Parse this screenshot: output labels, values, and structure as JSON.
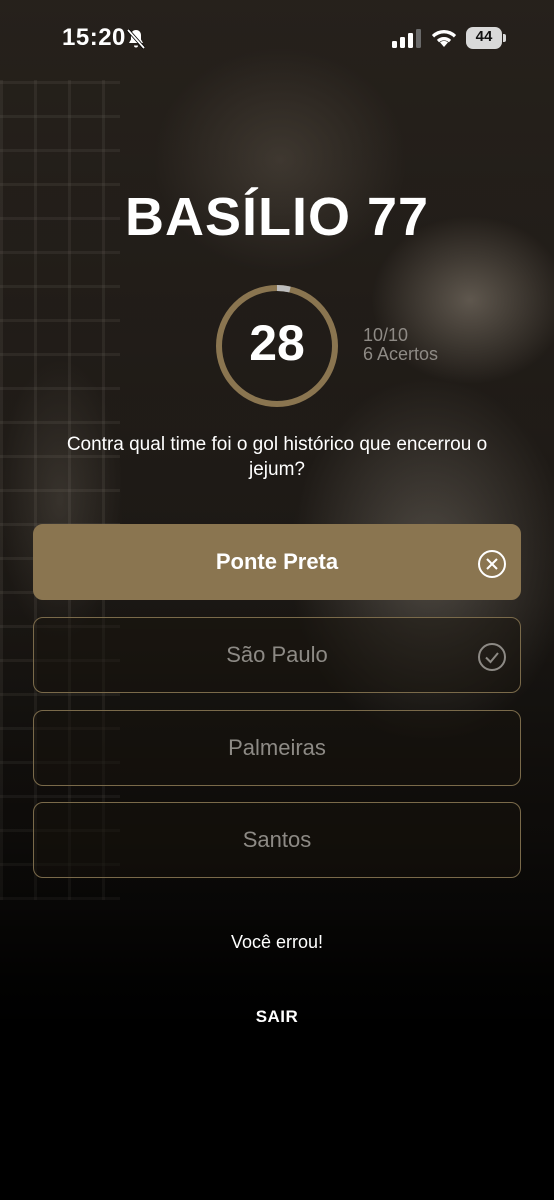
{
  "status_bar": {
    "time": "15:20",
    "battery": "44",
    "icons": [
      "bell-slash-icon",
      "signal-icon",
      "wifi-icon",
      "battery-icon"
    ]
  },
  "quiz": {
    "title": "BASÍLIO 77",
    "timer": "28",
    "progress": "10/10",
    "score": "6 Acertos",
    "question": "Contra qual time foi o gol histórico que encerrou o jejum?",
    "options": [
      {
        "label": "Ponte Preta",
        "state": "selected-wrong",
        "icon": "x-circle-icon"
      },
      {
        "label": "São Paulo",
        "state": "correct",
        "icon": "check-circle-icon"
      },
      {
        "label": "Palmeiras",
        "state": "default"
      },
      {
        "label": "Santos",
        "state": "default"
      }
    ],
    "feedback": "Você errou!",
    "exit_label": "SAIR"
  },
  "colors": {
    "accent": "#8a7550",
    "ring": "#8a7550",
    "option_border": "#7a6a4a",
    "muted_text": "#8e8a85"
  }
}
